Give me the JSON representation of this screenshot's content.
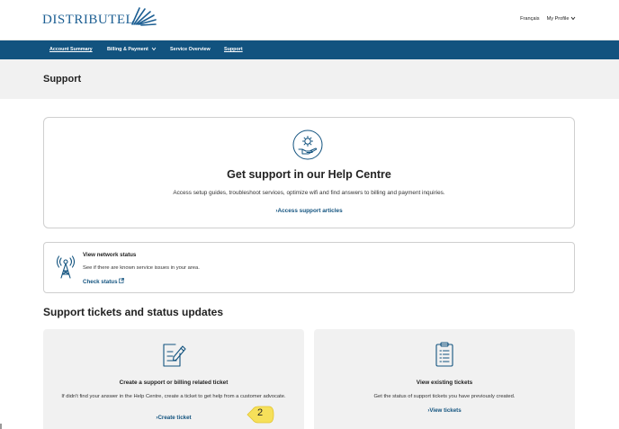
{
  "header": {
    "logo_text": "DISTRIBUTEL",
    "language_link": "Français",
    "profile_link": "My Profile",
    "profile_chevron": "chevron-down-icon"
  },
  "nav": {
    "items": [
      {
        "label": "Account Summary"
      },
      {
        "label": "Billing & Payment"
      },
      {
        "label": "Service Overview"
      },
      {
        "label": "Support"
      }
    ]
  },
  "page": {
    "title": "Support"
  },
  "help_centre": {
    "icon": "hand-gear-icon",
    "heading": "Get support in our Help Centre",
    "description": "Access setup guides, troubleshoot services, optimize wifi and find answers to billing and payment inquiries.",
    "link": "Access support articles"
  },
  "network_status": {
    "icon": "antenna-icon",
    "title": "View network status",
    "description": "See if there are known service issues in your area.",
    "link": "Check status"
  },
  "tickets": {
    "section_title": "Support tickets and status updates",
    "create": {
      "icon": "edit-document-icon",
      "title": "Create a support or billing related ticket",
      "description": "If didn't find your answer in the Help Centre, create a ticket to get help from a customer advocate.",
      "link": "Create ticket"
    },
    "view": {
      "icon": "clipboard-list-icon",
      "title": "View existing tickets",
      "description": "Get the status of support tickets you have previously created.",
      "link": "View tickets"
    }
  },
  "callout": {
    "number": "2"
  },
  "colors": {
    "brand_blue": "#12537f",
    "callout_yellow": "#f6e05a",
    "band_gray": "#f1f1f1"
  }
}
